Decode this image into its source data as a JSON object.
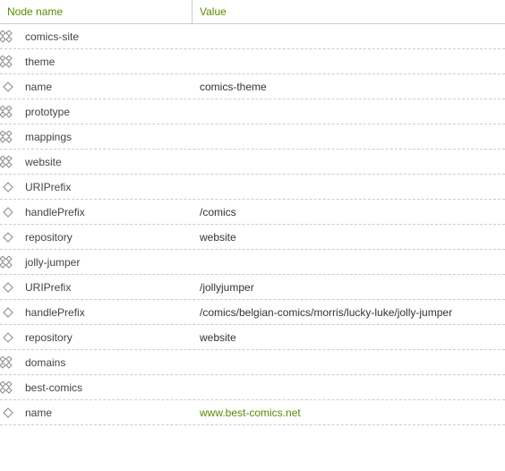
{
  "header": {
    "name_col": "Node name",
    "value_col": "Value"
  },
  "tree": [
    {
      "depth": 0,
      "type": "group",
      "label": "comics-site",
      "value": ""
    },
    {
      "depth": 1,
      "type": "group",
      "label": "theme",
      "value": ""
    },
    {
      "depth": 2,
      "type": "leaf",
      "label": "name",
      "value": "comics-theme"
    },
    {
      "depth": 1,
      "type": "group",
      "label": "prototype",
      "value": ""
    },
    {
      "depth": 1,
      "type": "group",
      "label": "mappings",
      "value": ""
    },
    {
      "depth": 2,
      "type": "group",
      "label": "website",
      "value": ""
    },
    {
      "depth": 3,
      "type": "leaf",
      "label": "URIPrefix",
      "value": ""
    },
    {
      "depth": 3,
      "type": "leaf",
      "label": "handlePrefix",
      "value": "/comics"
    },
    {
      "depth": 3,
      "type": "leaf",
      "label": "repository",
      "value": "website"
    },
    {
      "depth": 2,
      "type": "group",
      "label": "jolly-jumper",
      "value": ""
    },
    {
      "depth": 3,
      "type": "leaf",
      "label": "URIPrefix",
      "value": "/jollyjumper"
    },
    {
      "depth": 3,
      "type": "leaf",
      "label": "handlePrefix",
      "value": "/comics/belgian-comics/morris/lucky-luke/jolly-jumper"
    },
    {
      "depth": 3,
      "type": "leaf",
      "label": "repository",
      "value": "website"
    },
    {
      "depth": 1,
      "type": "group",
      "label": "domains",
      "value": ""
    },
    {
      "depth": 2,
      "type": "group",
      "label": "best-comics",
      "value": ""
    },
    {
      "depth": 3,
      "type": "leaf",
      "label": "name",
      "value": "www.best-comics.net",
      "link": true
    }
  ]
}
